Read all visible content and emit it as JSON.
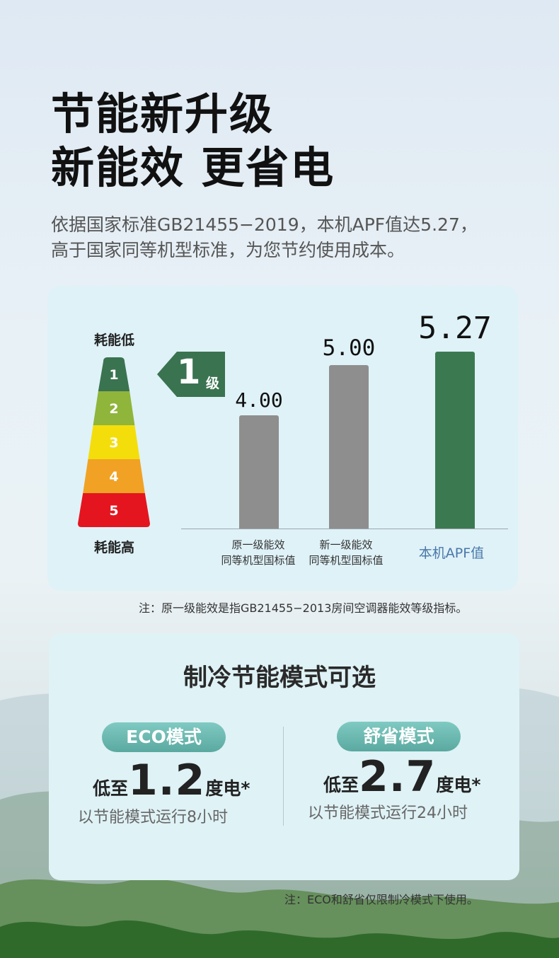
{
  "headline": {
    "line1": "节能新升级",
    "line2": "新能效 更省电"
  },
  "intro": {
    "line1": "依据国家标准GB21455−2019，本机APF值达5.27，",
    "line2": "高于国家同等机型标准，为您节约使用成本。"
  },
  "energy_scale": {
    "top_label": "耗能低",
    "bottom_label": "耗能高",
    "levels": [
      "1",
      "2",
      "3",
      "4",
      "5"
    ],
    "colors": [
      "#3a7350",
      "#8fb53b",
      "#f3de0c",
      "#f1a224",
      "#e4151f"
    ],
    "badge_number": "1",
    "badge_unit": "级",
    "badge_color": "#3a7350"
  },
  "chart_data": {
    "type": "bar",
    "categories": [
      "原一级能效同等机型国标值",
      "新一级能效同等机型国标值",
      "本机APF值"
    ],
    "values": [
      4.0,
      5.0,
      5.27
    ],
    "value_labels": [
      "4.00",
      "5.00",
      "5.27"
    ],
    "colors": [
      "#8e8e8e",
      "#8e8e8e",
      "#3b7a51"
    ],
    "title": "",
    "xlabel": "",
    "ylabel": "",
    "ylim": [
      1.75,
      5.27
    ]
  },
  "categories_display": [
    {
      "line1": "原一级能效",
      "line2": "同等机型国标值"
    },
    {
      "line1": "新一级能效",
      "line2": "同等机型国标值"
    },
    {
      "line1": "本机APF值",
      "line2": ""
    }
  ],
  "note1": "注：原一级能效是指GB21455−2013房间空调器能效等级指标。",
  "modes": {
    "title": "制冷节能模式可选",
    "eco": {
      "label": "ECO模式",
      "prefix": "低至",
      "value": "1.2",
      "suffix": "度电*",
      "desc": "以节能模式运行8小时"
    },
    "comfort": {
      "label": "舒省模式",
      "prefix": "低至",
      "value": "2.7",
      "suffix": "度电*",
      "desc": "以节能模式运行24小时"
    }
  },
  "note2": "注：ECO和舒省仅限制冷模式下使用。"
}
